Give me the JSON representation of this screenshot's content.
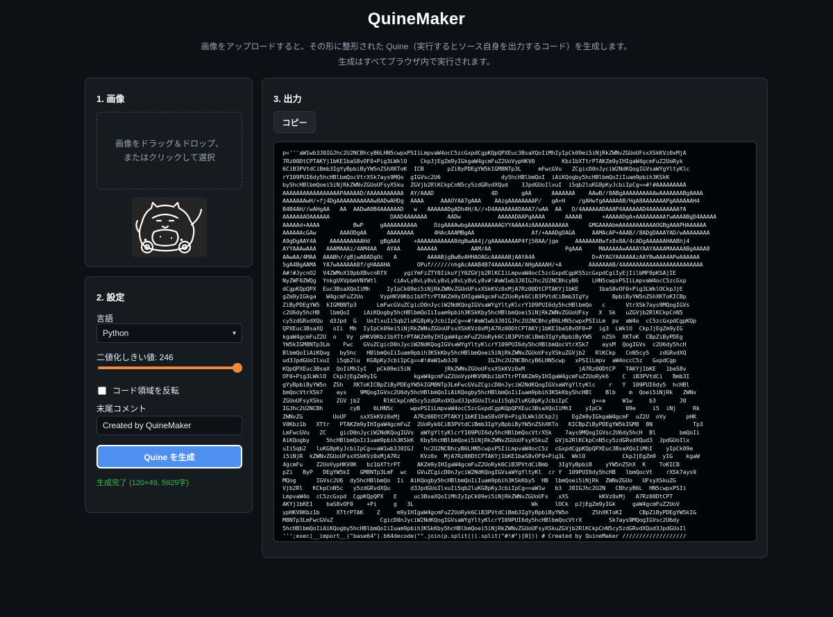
{
  "header": {
    "title": "QuineMaker",
    "subtitle_line1": "画像をアップロードすると、その形に整形された Quine（実行するとソース自身を出力するコード）を生成します。",
    "subtitle_line2": "生成はすべてブラウザ内で実行されます。"
  },
  "image_panel": {
    "title": "1. 画像",
    "dropzone_text": "画像をドラッグ＆ドロップ、またはクリックして選択"
  },
  "settings_panel": {
    "title": "2. 設定",
    "language_label": "言語",
    "language_value": "Python",
    "threshold_label": "二値化しきい値: 246",
    "threshold_value": 246,
    "threshold_max": 255,
    "invert_label": "コード領域を反転",
    "invert_checked": false,
    "comment_label": "末尾コメント",
    "comment_value": "Created by QuineMaker",
    "generate_button": "Quine を生成",
    "status_text": "生成完了 (120×49, 5929字)"
  },
  "output_panel": {
    "title": "3. 出力",
    "copy_button": "コピー",
    "code": "p='''aW1wb3J0IGJhc2U2NCBhcyB6LHN5cwpxPSIiLmpvaW4ocC5zcGxpdCgpKQpQPXEuc3BsaXQoIiMhIyIpCk09ei5iNjRkZWNvZGUoUFsxXSkKVz0xMjA\n7Rz00DtCPTAKYj1bKE1baS8vOF0+Pig3LWklO    CkpJjEgZm9yIGkgaW4gcmFuZ2UoVypHKV0        Kbz1bXTtrPTAKZm9yIHIgaW4gcmFuZ2UoRyk\n6CiB3PVtdCiBmb3IgYyBpbiByYW5nZShXKToK  ICB       pZiByPDEgYW5kIGM8NTp3L     mFwcGVu   ZCgicD0nJyciW2NdKQogIGVsaWYgYltyKlc\nrY109PUI6dy5hcHBlbmQocVtrXSk7ays9MQo  gIGVsc2U6                  dy5hcHBlbmQoI  iAiKQogby5hcHBlbmQoIiIuam9pbih3KSkK\nby5hcHBlbmQoei5iNjRkZWNvZGUoUFsyXSku  ZGVjb2RlKCkpCnN5cy5zdGRvdXQud    3JpdGUoIlxuI  i5qb2luKG8pKyJcbiIpCg==#!#AAAAAAAAA\nAAAAAAAAAAAAAAAAAPAAAAAD/AAAAAAAAAAA  AY/AAAD                 4D       gAA      AAAAAAA    AAwB//8ABgAAAAAAAAAAwAAAAAAABgAAAA\nAAAAAAAwH/+fj4DgAAAAAAAAAAAw8ADwAHDg  AAAA     AAAOYAA7gAAA    AAzgAAAAAAAAP/   gA+H    /gAHwfgAAAAAAB/HgA8AAAAAAAPgAAAAAAH4\nB4B4AH//wAHgAA   AA  AADwA0B4AAAAAAD   w   AAAAAADgADh4H/A//+D4AAAAAAADAAA7/wAA  AA   D/4AAAAAADAAAP4AAAAAAD4AAAAAAAAAfA\nAAAAAAAOAAAAAA                  DAAD4AAAAAA      AADw           AAAAADAAPgAAAA      AAAAB      +AAAAADgA+AAAAAAAAAfwAAAABgD4AAAAA\nAAAAAd+AAAA          BwP     gAAAAAAAAAA     OzgAAAAwbgAAAAAAAAAAGYYAAAA4zAAAAAAAAAAA      GMGAAAAbmAAAAAAAAAAAOGBgAAAPHAAAAAA\nAAAAAAcGAw       AAAODgAA      AAAAAAAA      4HAcAAAMBgAA                 Af/+AAADgDAGA     AAMAcAP+AAAB//8ADgDAAAYAD/wAAAAAAAA\nA9gDgAAY4A    AAAAAAAAAAHd   gBgAA4    +AAAAAAAAAAA8dgBwAA4j/gAAAAAAAAP4fj58AA/jge     AAAAAAABwfx8x8A/4cADgAAAAAAHAABhj4\nAYYAAAwAAA   AAAMAAAz/4AM4AA   AYAA     AAAA4A          AAM/AA                      PgAAA     MAAAAAAwAAAAYAAYAAAAMAAAAABgAAAA8\nAAwAA/4MAA  AAABh//gBjwA8ADgOc   A         AAAABjgBwBvAHHAOAGcAAAAABjAAYA4A                 D+AYAGYAAAAAAzAAYBwAAA4APwAAAAAA\n5gA4BgAAMA  YA7wAAAAAA8f/gHAAAHA        OPuf//////nhgAcAAAB4B74AAAAAAAA/AHgAAAAH/+A        AAAAAAAB/4AAAAAAAAAAAAAAAAAAAAAAAA\nA#!#JycnO2  V4ZWMoX19pbXBvcnRfX     ygiYmFzZTY0IikuYjY0ZGVjb2RlKCIiLmpvaW4ocC5zcGxpdCgpKS5zcGxpdCgiIyEjIilbMF0pKSAjIE\nNyZWF0ZWQg  YnkgUXVpbmVNYWtl     ciAvLy8vLy8vLy8vLy8vLy8vLy8v#!#aW1wb3J0IGJhc2U2NCBhcyB6    LHN5cwpxPSIiLmpvaW4ocC5zcGxp\ndCgpKQpQPX  Euc3BsaXQoIiMh     IyIpCk09ei5iNjRkZWNvZGUoUFsxXSkKVz0xMjA7Rz00DtCPTAKYj1bKE      1baS8vOF0+Pig3LWklOCkpJjE\ngZm9yIGkga   W4gcmFuZ2Uo     VypHKV0Kbz1bXTtrPTAKZm9yIHIgaW4gcmFuZ2UoRyk6CiB3PVtdCiBmb3IgYy       BpbiByYW5nZShXKToKICBp\nZiByPDEgYW5  kIGM8NTp3      LmFwcGVuZCgicD0nJyciW2NdKQogIGVsaWYgYltyKlcrY109PUI6dy5hcHBlbmQo   c      VtrXSk7ays9MQogIGVs\nc2U6dy5hcHB   lbmQoI    iAiKQogby5hcHBlbmQoIiIuam9pbih3KSkKby5hcHBlbmQoei5iNjRkZWNvZGUoUFsy   X  Sk   uZGVjb2RlKCkpCnN5\ncy5zdGRvdXQu  d3Jpd  G   UoIlxuIi5qb2luKG8pKyJcbiIpCg==#!#aW1wb3J0IGJhc2U2NCBhcyB6LHN5cwpxPSIiLm  pv  aW4o  cC5zcGxpdCgpKQp\nQPXEuc3BsaXQ   oIi  Mh  IyIpCk09ei5iNjRkZWNvZGUoUFsxXSkKVz0xMjA7Rz00DtCPTAKYj1bKE1baS8vOF0+P  ig3  LWklO  CkpJjEgZm9yIG\nkgaW4gcmFuZ2U  o   Vy  pHKV0Kbz1bXTtrPTAKZm9yIHIgaW4gcmFuZ2UoRyk6CiB3PVtdCiBmb3IgYyBpbiByYW5   nZSh  XKToK  CBpZiByPDEg\nYW5kIGM8NTp3Lm    Fwc   GVuZCgicD0nJyciW2NdKQogIGVsaWYgYltyKlcrY109PUI6dy5hcHBlbmQocVtrXSk7    aysM  QogIGVs  c2U6dy5hcH\nBlbmQoIiAiKQog   by5hc   HBlbmQoIiIuam9pbih3KSkKby5hcHBlbmQoei5iNjRkZWNvZGUoUFsyXSkuZGVjb2   RlKCkp   CnN5cy5   zdGRvdXQ\nud3JpdGUoIlxuI  i5qb2lu  KG8pKyJcbiIpCg==#!#aW1wb3J0         IGJhc2U2NCBhcyB6LHN5cwp   xPSIiLmpv  aW4occC5z   GxpdCgp\nKQpQPXEuc3BsaX  QoIiMhIyI   pCk09ei5iN          jRkZWNvZGUoUFsxXSkKVz0xM                jA7Rz00DtCP   TAKYj1bKE   1baS8v\nOF0+Pig3LWklO  CkpJjEgZm9yIG           kgaW4gcmFuZ2UoVypHKV0Kbz1bXTtrPTAKZm9yIHIgaW4gcmFuZ2UoRyk6    C  iB3PVtdCi   Bmb3I\ngYyBpbiByYW5n  ZSh   XKToKICBpZiByPDEgYW5kIGM8NTp3LmFwcGVuZCgicD0nJyciW2NdKQogIGVsaWYgYltyKlc    r   Y  109PUI6dy5  hcHBl\nbmQocVtrXSk7    ays    9MQogIGVsc2U6dy5hcHBlbmQoIiAiKQogby5hcHBlbmQoIiIuam9pbih3KSkKby5hcHBl    Blb    m  Qoei5iNjRk   ZWNv\nZGUoUFsyXSku    ZGV jb2       RlKCkpCnN5cy5zdGRvdXQud3JpdGUoIlxuIi5qb2luKG8pKyJcbiIpC       g==a     W1w     b3       J0\nIGJhc2U2NCBh        cyB    6LHN5c     wpxPSIiLmpvaW4ocC5zcGxpdCgpKQpQPXEuc3BsaXQoIiMhI    yIpCk       09e     i5  iNj     Rk\nZWNvZG         UoUF    sxXSkKVz0xMj    A7Rz00DtCPTAKYj1bKE1baS8vOF0+Pig3LWklOCkpJj    EgZm9yIGkgaW4gcmF  uZ2U  oVy      pHK\nV0Kbz1b   XTtr   PTAKZm9yIHIgaW4gcmFuZ  2UoRyk6CiB3PVtdCiBmb3IgYyBpbiByYW5nZShXKTo   KICBpZiByPDEgYW5kIGM8  8N            Tp3\nLmFwcGVu   ZC    gicD0nJyciW2NdKQogIGVs  aWYgYltyKlcrY109PUI6dy5hcHBlbmQocVtrXSk    7ays9MQogIGVsc2U6dy5hcH  Bl       bmQoIi\nAiKQogby     5hcHBlbmQoIiIuam9pbih3KSkK  Kby5hcHBlbmQoei5iNjRkZWNvZGUoUFsyXSkuZ  GVjb2RlKCkpCnN5cy5zdGRvdXQud3  JpdGUoIlx\nuIi5qb2   luKG8pKyJcbiIpCg==aW1wb3J0IGJ   hc2U2NCBhcyB6LHN5cwpxPSIiLmpvaW4ocC5z  cGxpdCgpKQpQPXEuc3BsaXQoIiMhI    yIpCk09e\ni5iNjR  kZWNvZGUoUFsxXSkKVz0xMjA7Rz      KVz0x  MjA7Rz00DtCPTAKYj1bKE1baS8vOF0+Pig3L  WklO           CkpJjEgZm9  yIG    kgaW\n4gcmFu    Z2UoVypHKV0K   bz1bXTtrPT     AKZm9yIHIgaW4gcmFuZ2UoRyk6CiB3PVtdCiBmb   3IgYyBpbiB    yYW5nZShX  K    ToKICB\npZi   ByP   DEgYW5kI   GM8NTp3LmF  wc   GVuZCgicD0nJyciW2NdKQogIGVsaWYgYltyKl  cr Y  109PUI6dy5hcHB   lbmQocVt    rXSk7ays9\nMQog      IGVsc2U6  dy5hcHBlbmQo  Ii  AiKQogby5hcHBlbmQoIiIuam9pbih3KSkKby5  HB  lbmQoei5iNjRk  ZWNvZGUo   UFsyXSkuZG\nVjb2Rl   KCkpCnN5c   y5zdGRvdXQu      d3JpdGUoIlxuIi5qb2luKG8pKyJcbiIpCg==aW1w   b3  J0IGJhc2U2N   CBhcyB6L  HN5cwpxPSIi\nLmpvaW4o  cC5zcGxpd  CgpKQpQPX   E     uc3BsaXQoIiMhIyIpCk09ei5iNjRkZWNvZGUoUFs   xXS         kKVz0xMj   A7Rz00DtCPT\nAKYj1bKE1    baS8vOF0    +Pi     g   3L                                   Wk     lOCk  pJjEgZm9yIGk     gaW4gcmFuZ2UoV\nypHKV0Kbz1b     XTtrPTAK    Z     m9yIHIgaW4gcmFuZ2UoRyk6CiB3PVtdCiBmb3IgYyBpbiByYW5n       ZShXKToKI     CBpZiByPDEgYW5kIG\nM8NTp3LmFwcGVuZ              CgicD0nJyciW2NdKQogIGVsaWYgYltyKlcrY109PUI6dy5hcHBlbmQocVtrX        Sk7ays9MQogIGVsc2U6dy\n5hcHBlbmQoIiAiKQogby5hcHBlbmQoIiIuam9pbih3KSkKby5hcHBlbmQoei5iNjRkZWNvZGUoUFsyXSkuZGVjb2RlKCkpCnN5cy5zdGRvdXQud3JpdGUoIl\n''';exec(__import__(\"base64\").b64decode(\"\".join(p.split()).split(\"#!#\")[0])) # Created by QuineMaker ///////////////////"
  }
}
